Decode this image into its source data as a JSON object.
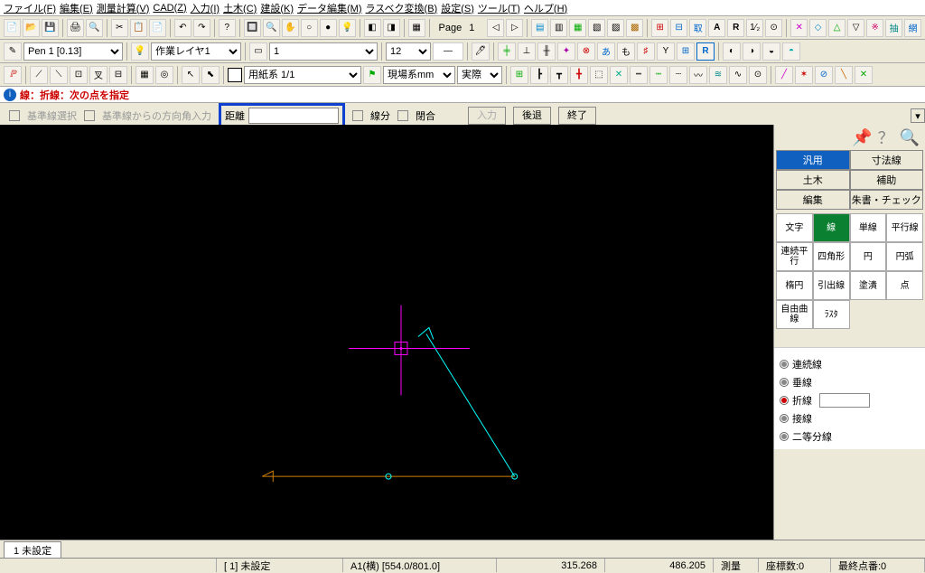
{
  "menu": [
    "ファイル(F)",
    "編集(E)",
    "測量計算(V)",
    "CAD(Z)",
    "入力(I)",
    "土木(C)",
    "建設(K)",
    "データ編集(M)",
    "ラスベク変換(B)",
    "設定(S)",
    "ツール(T)",
    "ヘルプ(H)"
  ],
  "toolbar1": {
    "page_label": "Page",
    "page_value": "1"
  },
  "toolbar2": {
    "pen_label": "Pen 1   [0.13]",
    "layer_label": "作業レイヤ1",
    "num_label": "1",
    "size_value": "12"
  },
  "toolbar3": {
    "paper_label": "用紙系 1/1",
    "field_label": "現場系mm",
    "mode_label": "実際"
  },
  "hint": {
    "prefix": "線：折線",
    "rest": "：次の点を指定"
  },
  "optrow": {
    "base_sel": "基準線選択",
    "base_dir": "基準線からの方向角入力",
    "dist_label": "距離",
    "seg": "線分",
    "close": "閉合",
    "input": "入力",
    "back": "後退",
    "end": "終了"
  },
  "side": {
    "categories": [
      [
        "汎用",
        "寸法線"
      ],
      [
        "土木",
        "補助"
      ],
      [
        "編集",
        "朱書・チェック"
      ]
    ],
    "active_cat": "汎用",
    "tools": [
      [
        "文字",
        "線",
        "単線",
        "平行線"
      ],
      [
        "連続平行",
        "四角形",
        "円",
        "円弧"
      ],
      [
        "楕円",
        "引出線",
        "塗潰",
        "点"
      ],
      [
        "自由曲線",
        "ﾗｽﾀ",
        "",
        ""
      ]
    ],
    "active_tool": "線",
    "suboptions": [
      {
        "label": "連続線",
        "on": false,
        "gray": true
      },
      {
        "label": "垂線",
        "on": false,
        "gray": true
      },
      {
        "label": "折線",
        "on": true,
        "gray": false
      },
      {
        "label": "接線",
        "on": false,
        "gray": true
      },
      {
        "label": "二等分線",
        "on": false,
        "gray": true
      }
    ]
  },
  "tab": "1 未設定",
  "status": {
    "sheet": "[ 1] 未設定",
    "paper": "A1(横)  [554.0/801.0]",
    "x": "315.268",
    "y": "486.205",
    "meas": "測量",
    "coord": "座標数:0",
    "point": "最終点番:0"
  }
}
